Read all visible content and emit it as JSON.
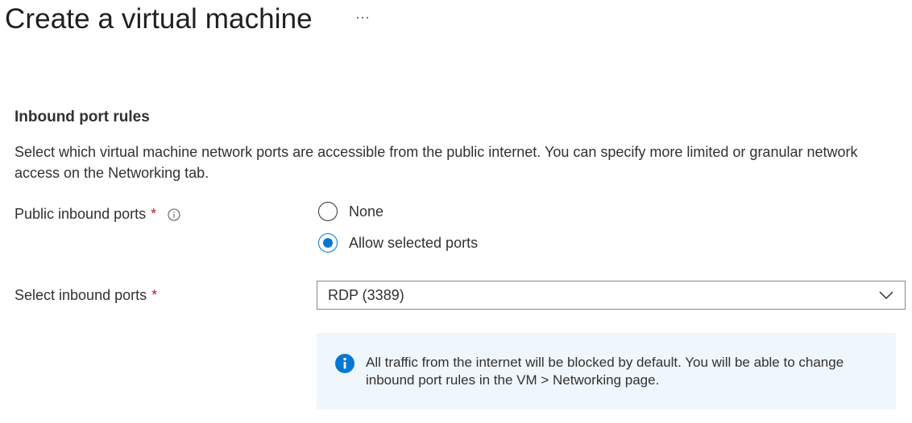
{
  "page": {
    "title": "Create a virtual machine",
    "more_label": "···"
  },
  "section": {
    "title": "Inbound port rules",
    "description": "Select which virtual machine network ports are accessible from the public internet. You can specify more limited or granular network access on the Networking tab."
  },
  "public_inbound_ports": {
    "label": "Public inbound ports",
    "required_mark": "*",
    "info_icon": "info-circle-icon",
    "options": [
      {
        "label": "None",
        "selected": false
      },
      {
        "label": "Allow selected ports",
        "selected": true
      }
    ]
  },
  "select_inbound_ports": {
    "label": "Select inbound ports",
    "required_mark": "*",
    "value": "RDP (3389)",
    "icon": "chevron-down-icon"
  },
  "info_message": {
    "icon": "info-filled-icon",
    "text": "All traffic from the internet will be blocked by default. You will be able to change inbound port rules in the VM > Networking page."
  },
  "colors": {
    "accent": "#0078d4",
    "required": "#a4262c",
    "info_background": "#eff6fc",
    "text": "#323130"
  }
}
